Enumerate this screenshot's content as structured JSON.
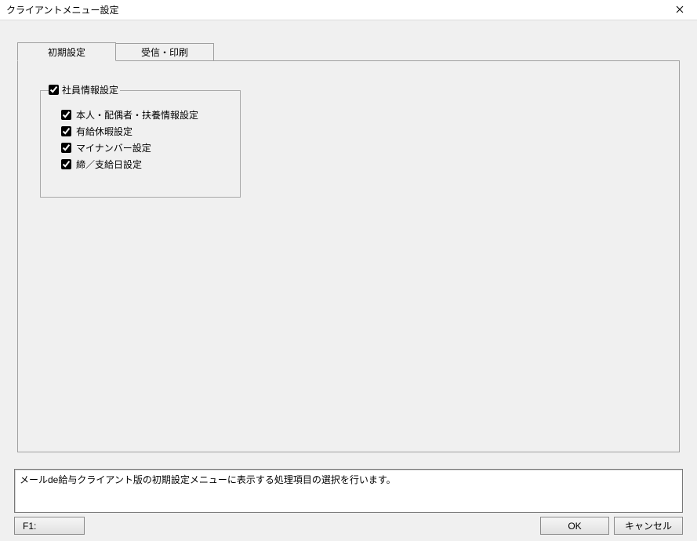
{
  "window": {
    "title": "クライアントメニュー設定"
  },
  "tabs": {
    "initial": "初期設定",
    "receive_print": "受信・印刷"
  },
  "groupbox": {
    "legend": "社員情報設定",
    "items": {
      "personal": "本人・配偶者・扶養情報設定",
      "paid_leave": "有給休暇設定",
      "mynumber": "マイナンバー設定",
      "closing_payday": "締／支給日設定"
    }
  },
  "status": {
    "text": "メールde給与クライアント版の初期設定メニューに表示する処理項目の選択を行います。"
  },
  "buttons": {
    "f1": "F1:",
    "ok": "OK",
    "cancel": "キャンセル"
  }
}
